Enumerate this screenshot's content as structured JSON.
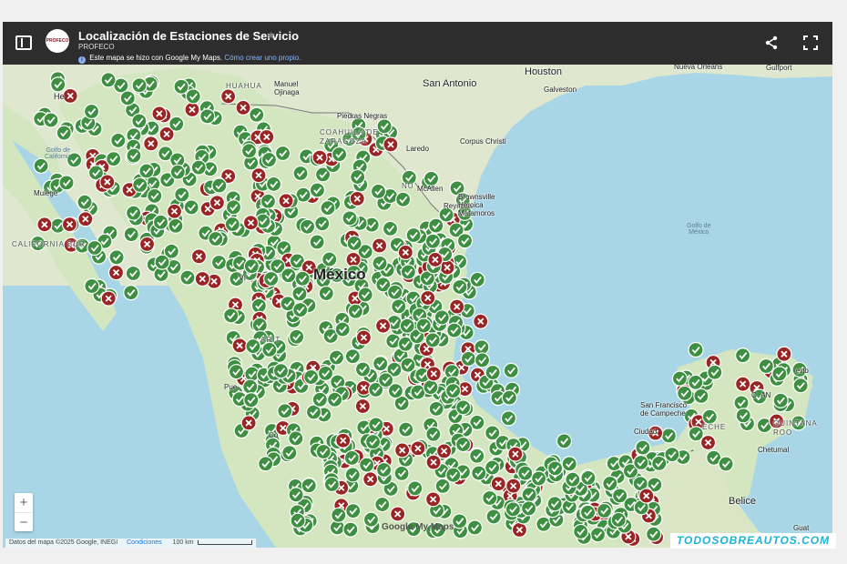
{
  "header": {
    "title": "Localización de Estaciones de Servicio",
    "subtitle": "PROFECO",
    "notice_prefix": "Este mapa se hizo con Google My Maps.",
    "notice_link": "Cómo crear uno propio.",
    "logo_text": "PROFECO"
  },
  "labels": {
    "chihuahua": "HUAHUA",
    "manuel": "Manuel\nOjinaga",
    "piedras": "Piedras Negras",
    "coahuila": "COAHUILA DE\nZARAGOZA",
    "laredo": "Laredo",
    "nuevo": "NU",
    "houston": "Houston",
    "san_antonio": "San Antonio",
    "galveston": "Galveston",
    "new_orleans": "Nueva Orleans",
    "gulfport": "Gulfport",
    "corpus": "Corpus Christi",
    "mcallen": "McAllen",
    "reynosa": "Reynosa",
    "brownsville": "Brownsville\nHeroica\nMatamoros",
    "golfo_mexico": "Golfo de\nMéxico",
    "golfo_california": "Golfo de\nCalifornia",
    "mulege": "Mulegé",
    "calif_sur": "CALIFORNIA SUR",
    "he": "He",
    "mexico": "México",
    "vi": "Vi",
    "arit": "ARIT",
    "pue": "Pue",
    "colima": "Co",
    "san_francisco": "San Francisco\nde Campeche",
    "ciudad": "Ciudad",
    "campeche": "ECHE",
    "quintana": "QUINTANA\nROO",
    "chetumal": "Chetumal",
    "belice": "Belice",
    "can": "C  AN",
    "erto": "erto",
    "guat": "Guat"
  },
  "zoom": {
    "in": "+",
    "out": "−"
  },
  "attribution": {
    "data": "Datos del mapa ©2025 Google, INEGI",
    "terms": "Condiciones",
    "scale": "100 km"
  },
  "branding": {
    "google_my_maps": "Google My Maps"
  },
  "watermark": "TODOSOBREAUTOS.COM",
  "colors": {
    "header_bg": "#2d2d2d",
    "water": "#a9d6e6",
    "land": "#d9e7c9",
    "open_marker": "#3f8f42",
    "closed_marker": "#9a2525"
  },
  "markers": {
    "open_icon": "check-icon",
    "closed_icon": "x-icon"
  }
}
